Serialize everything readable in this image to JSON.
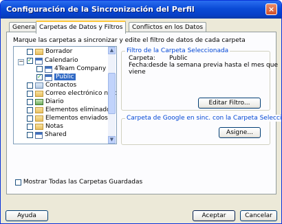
{
  "window": {
    "title": "Configuración de la Sincronización del Perfil",
    "close_glyph": "×"
  },
  "tabs": [
    {
      "label": "General",
      "active": false
    },
    {
      "label": "Carpetas de Datos y Filtros",
      "active": true
    },
    {
      "label": "Conflictos en los Datos",
      "active": false
    }
  ],
  "instruction": "Marque las carpetas a sincronizar y edite el filtro de datos de cada carpeta",
  "tree": {
    "expander_glyph": "−",
    "items": [
      {
        "label": "Borrador",
        "checked": false,
        "icon": "folder-icon"
      },
      {
        "label": "Calendario",
        "checked": true,
        "icon": "calendar-icon"
      },
      {
        "label": "4Team Company",
        "checked": false,
        "icon": "calendar-icon"
      },
      {
        "label": "Public",
        "checked": true,
        "icon": "calendar-icon",
        "selected": true
      },
      {
        "label": "Contactos",
        "checked": false,
        "icon": "contacts-icon"
      },
      {
        "label": "Correo electrónico no des",
        "checked": false,
        "icon": "folder-icon"
      },
      {
        "label": "Diario",
        "checked": false,
        "icon": "journal-icon"
      },
      {
        "label": "Elementos eliminados",
        "checked": false,
        "icon": "folder-icon"
      },
      {
        "label": "Elementos enviados",
        "checked": false,
        "icon": "folder-icon"
      },
      {
        "label": "Notas",
        "checked": false,
        "icon": "folder-icon"
      },
      {
        "label": "Shared",
        "checked": false,
        "icon": "calendar-icon"
      }
    ],
    "scroll_up_glyph": "▲",
    "scroll_down_glyph": "▼"
  },
  "filter_group": {
    "title": "Filtro de la Carpeta Seleccionada",
    "carpeta_label": "Carpeta:",
    "carpeta_value": "Public",
    "fecha_label": "Fecha:",
    "fecha_value_line1": "desde la semana previa hasta el mes que",
    "fecha_value_line2": "viene",
    "edit_button": "Editar Filtro..."
  },
  "google_group": {
    "title": "Carpeta de Google en sinc. con la Carpeta Seleccionada",
    "assign_button": "Asigne..."
  },
  "show_all_label": "Mostrar Todas las Carpetas Guardadas",
  "footer": {
    "help": "Ayuda",
    "accept": "Aceptar",
    "cancel": "Cancelar"
  }
}
